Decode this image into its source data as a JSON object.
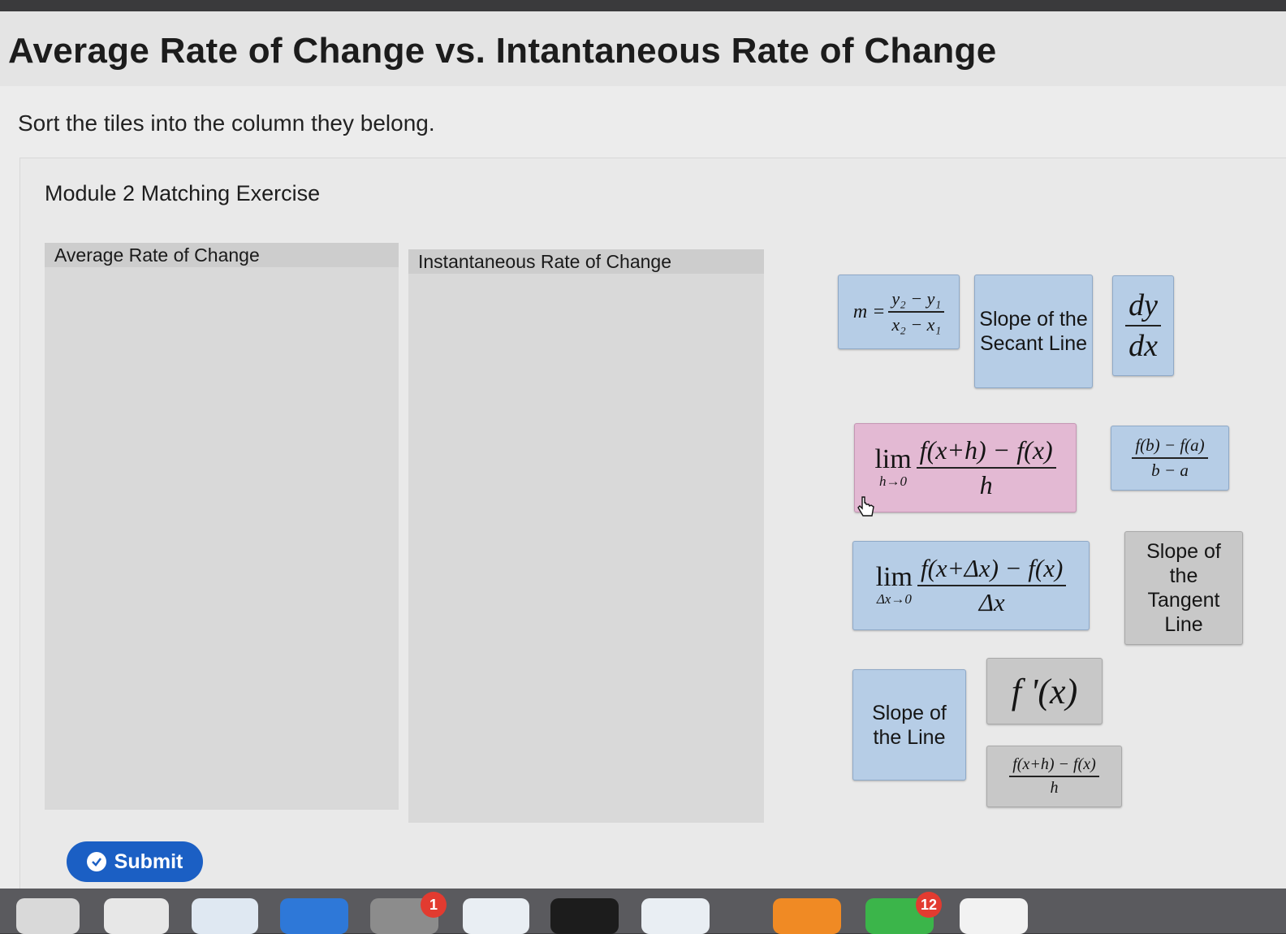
{
  "page": {
    "title": "Average Rate of Change vs. Intantaneous Rate of Change",
    "instructions": "Sort the tiles into the column they belong."
  },
  "exercise": {
    "title": "Module 2 Matching Exercise",
    "columns": [
      {
        "label": "Average Rate of Change"
      },
      {
        "label": "Instantaneous Rate of Change"
      }
    ]
  },
  "tiles": {
    "slope_formula": {
      "lhs": "m =",
      "num": "y₂ − y₁",
      "den": "x₂ − x₁",
      "color": "blue"
    },
    "secant": {
      "text": "Slope of the Secant Line",
      "color": "blue"
    },
    "dydx": {
      "num": "dy",
      "den": "dx",
      "color": "blue"
    },
    "limit_h": {
      "lim": "lim",
      "sub": "h→0",
      "num": "f(x+h) − f(x)",
      "den": "h",
      "color": "pink"
    },
    "interval": {
      "num": "f(b) − f(a)",
      "den": "b − a",
      "color": "blue"
    },
    "limit_dx": {
      "lim": "lim",
      "sub": "Δx→0",
      "num": "f(x+Δx) − f(x)",
      "den": "Δx",
      "color": "blue"
    },
    "tangent": {
      "text": "Slope of the Tangent Line",
      "color": "gray"
    },
    "line": {
      "text": "Slope of the Line",
      "color": "blue"
    },
    "fprime": {
      "text": "f '(x)",
      "color": "gray"
    },
    "diff_quotient": {
      "num": "f(x+h) − f(x)",
      "den": "h",
      "color": "gray"
    }
  },
  "submit": {
    "label": "Submit"
  },
  "dock": {
    "badges": [
      "1",
      "12"
    ]
  },
  "colors": {
    "tile_blue": "#b6cde6",
    "tile_gray": "#c8c8c8",
    "tile_pink": "#e3b9d3",
    "submit": "#1b5fc4"
  }
}
